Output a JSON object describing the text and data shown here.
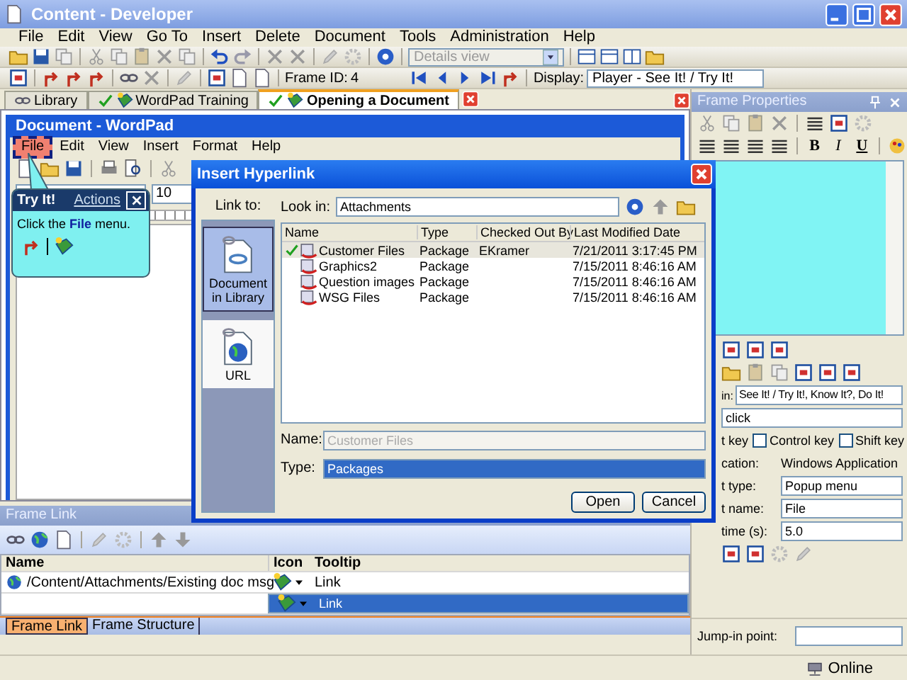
{
  "window": {
    "title": "Content - Developer"
  },
  "menu": [
    "File",
    "Edit",
    "View",
    "Go To",
    "Insert",
    "Delete",
    "Document",
    "Tools",
    "Administration",
    "Help"
  ],
  "toolbar": {
    "view_combo": "Details view",
    "frame_id_label": "Frame ID:",
    "frame_id": "4",
    "display_label": "Display:",
    "display_value": "Player - See It! / Try It!"
  },
  "tabs": [
    {
      "label": "Library",
      "selected": false,
      "checked": false
    },
    {
      "label": "WordPad Training",
      "selected": false,
      "checked": true
    },
    {
      "label": "Opening a Document",
      "selected": true,
      "checked": true
    }
  ],
  "frame": {
    "title": "Document - WordPad",
    "menu": [
      {
        "label": "File",
        "highlighted": true
      },
      {
        "label": "Edit",
        "highlighted": false
      },
      {
        "label": "View",
        "highlighted": false
      },
      {
        "label": "Insert",
        "highlighted": false
      },
      {
        "label": "Format",
        "highlighted": false
      },
      {
        "label": "Help",
        "highlighted": false
      }
    ],
    "font_size": "10"
  },
  "bubble": {
    "title": "Try It!",
    "link": "Actions",
    "text": "Click the **File** menu."
  },
  "dialog": {
    "title": "Insert Hyperlink",
    "link_to_label": "Link to:",
    "places": [
      {
        "label": "Document in Library",
        "selected": true,
        "kind": "library"
      },
      {
        "label": "URL",
        "selected": false,
        "kind": "url"
      }
    ],
    "look_in_label": "Look in:",
    "look_in": "Attachments",
    "columns": [
      "Name",
      "Type",
      "Checked Out By",
      "Last Modified Date"
    ],
    "rows": [
      {
        "name": "Customer Files",
        "type": "Package",
        "checked_out_by": "EKramer",
        "modified": "7/21/2011 3:17:45 PM",
        "checked_out": true,
        "selected": true
      },
      {
        "name": "Graphics2",
        "type": "Package",
        "modified": "7/15/2011 8:46:16 AM",
        "checked_out": false,
        "selected": false
      },
      {
        "name": "Question images",
        "type": "Package",
        "modified": "7/15/2011 8:46:16 AM",
        "checked_out": false,
        "selected": false
      },
      {
        "name": "WSG Files",
        "type": "Package",
        "modified": "7/15/2011 8:46:16 AM",
        "checked_out": false,
        "selected": false
      }
    ],
    "name_label": "Name:",
    "name_value": "Customer Files",
    "type_label": "Type:",
    "type_value": "Packages",
    "buttons": [
      "Open",
      "Cancel"
    ]
  },
  "frame_link": {
    "title": "Frame Link",
    "columns": [
      "Name",
      "Icon",
      "Tooltip"
    ],
    "rows": [
      {
        "name": "/Content/Attachments/Existing doc msg",
        "tooltip": "Link",
        "selected": false
      },
      {
        "tooltip": "Link",
        "selected": true
      }
    ],
    "tabs": [
      {
        "label": "Frame Link",
        "selected": true
      },
      {
        "label": "Frame Structure",
        "selected": false
      }
    ]
  },
  "properties": {
    "title": "Frame Properties",
    "format_buttons": [
      "B",
      "I",
      "U"
    ],
    "mode_label": "in:",
    "mode_value": "See It! / Try It!, Know It?, Do It!",
    "action": "click",
    "checkboxes": [
      {
        "label": "t key",
        "checked": false
      },
      {
        "label": "Control key",
        "checked": false
      },
      {
        "label": "Shift key",
        "checked": false
      }
    ],
    "fields": [
      {
        "label": "cation:",
        "value": "Windows Application",
        "kind": "text"
      },
      {
        "label": "t type:",
        "value": "Popup menu",
        "kind": "select"
      },
      {
        "label": "t name:",
        "value": "File",
        "kind": "input"
      },
      {
        "label": "time (s):",
        "value": "5.0",
        "kind": "select"
      }
    ],
    "jump_label": "Jump-in point:"
  },
  "status": "Online"
}
